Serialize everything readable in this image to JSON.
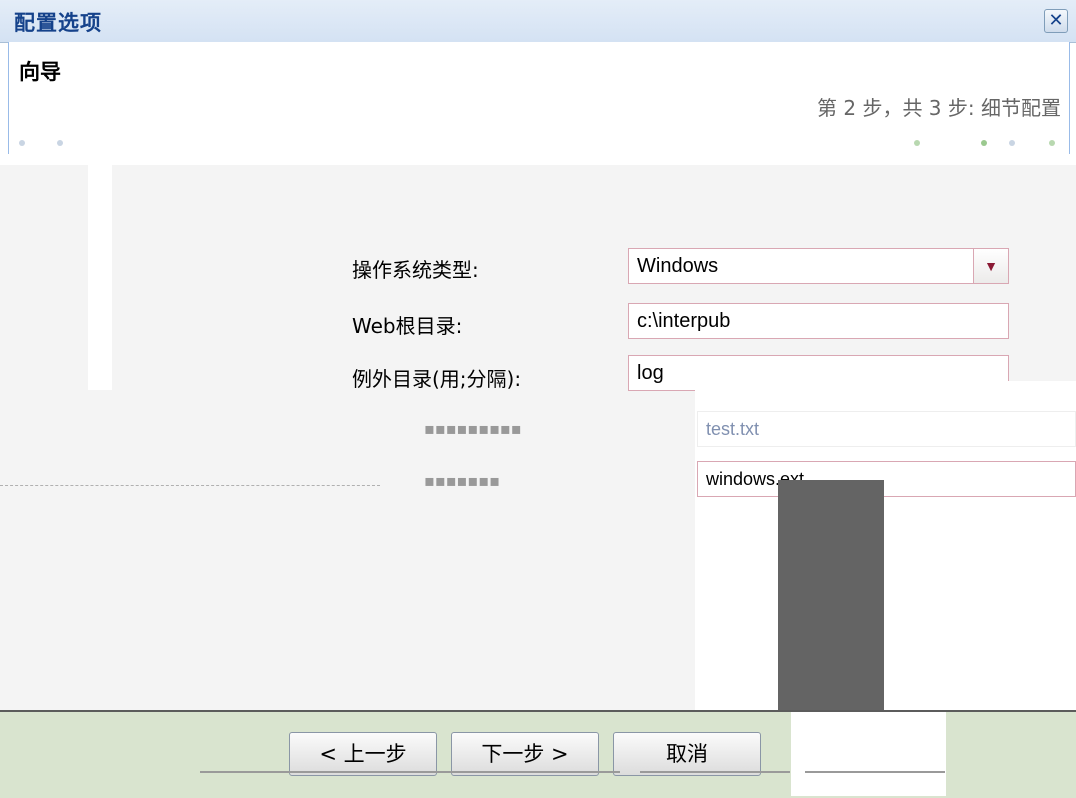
{
  "window": {
    "title": "配置选项",
    "close_glyph": "✕"
  },
  "wizard": {
    "title": "向导",
    "step_text": "第 2 步，共 3 步: 细节配置"
  },
  "form": {
    "os_type": {
      "label": "操作系统类型:",
      "value": "Windows"
    },
    "web_root": {
      "label": "Web根目录:",
      "value": "c:\\interpub"
    },
    "exclude_dirs": {
      "label": "例外目录(用;分隔):",
      "value": "log"
    },
    "row4_value": "test.txt",
    "row5_value": "windows.ext"
  },
  "buttons": {
    "prev": "< 上一步",
    "next": "下一步 >",
    "cancel": "取消"
  },
  "colors": {
    "title_text": "#15428b",
    "header_border": "#99bbe8",
    "field_border": "#d9a7b3",
    "content_bg": "#f4f4f4",
    "footer_bg": "#d9e4cf"
  }
}
